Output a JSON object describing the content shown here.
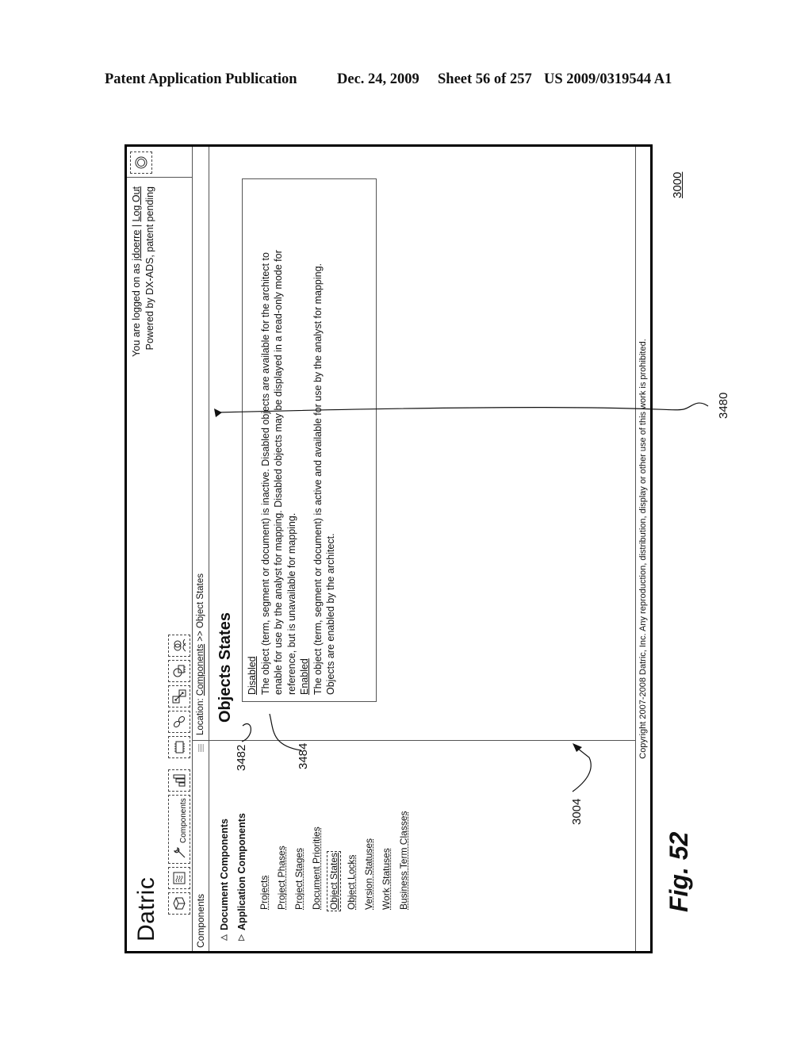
{
  "patent_header": {
    "publication": "Patent Application Publication",
    "date": "Dec. 24, 2009",
    "sheet": "Sheet 56 of 257",
    "number": "US 2009/0319544 A1"
  },
  "app": {
    "logo": "Datric",
    "toolbar": {
      "items": [
        {
          "icon": "cube-icon",
          "label": ""
        },
        {
          "icon": "wave-document-icon",
          "label": ""
        },
        {
          "icon": "wrench-icon",
          "label": "Components"
        },
        {
          "icon": "layout-blocks-icon",
          "label": ""
        },
        {
          "icon": "chip-icon",
          "label": ""
        },
        {
          "icon": "link-icon",
          "label": ""
        },
        {
          "icon": "map-arrows-icon",
          "label": ""
        },
        {
          "icon": "magnifier-chip-icon",
          "label": ""
        },
        {
          "icon": "users-icon",
          "label": ""
        }
      ]
    },
    "user": {
      "logged_prefix": "You are logged on as",
      "username": "jdoerre",
      "separator": "|",
      "logout": "Log Out",
      "powered_by": "Powered by DX-ADS, patent pending"
    },
    "help_icon": "help-circle-icon",
    "sidebar": {
      "header": "Components",
      "sections": [
        {
          "label": "Document Components",
          "expanded": false
        },
        {
          "label": "Application Components",
          "expanded": true
        }
      ],
      "items": [
        {
          "label": "Projects",
          "selected": false
        },
        {
          "label": "Project Phases",
          "selected": false
        },
        {
          "label": "Project Stages",
          "selected": false
        },
        {
          "label": "Document Priorities",
          "selected": false
        },
        {
          "label": "Object States",
          "selected": true
        },
        {
          "label": "Object Locks",
          "selected": false
        },
        {
          "label": "Version Statuses",
          "selected": false
        },
        {
          "label": "Work Statuses",
          "selected": false
        },
        {
          "label": "Business Term Classes",
          "selected": false
        }
      ]
    },
    "location": {
      "prefix": "Location:",
      "crumb_link": "Components",
      "separator": ">>",
      "current": "Object States"
    },
    "page_title": "Objects States",
    "definitions": [
      {
        "term": "Disabled",
        "lines": [
          "The object (term, segment or document) is inactive.  Disabled objects are available for the architect to",
          "enable for use by the analyst for mapping. Disabled objects may be displayed in a read-only mode for",
          "reference, but is unavailable for mapping."
        ]
      },
      {
        "term": "Enabled",
        "lines": [
          "The object (term, segment or document) is active and available for use by the analyst for mapping.",
          "Objects are enabled by the architect."
        ]
      }
    ],
    "footer": "Copyright 2007-2008 Datric, Inc.  Any reproduction, distribution, display or other use of this work is prohibited."
  },
  "annotations": {
    "ref_3480": "3480",
    "ref_3482": "3482",
    "ref_3484": "3484",
    "ref_3004": "3004",
    "ref_3000": "3000",
    "figure_label": "Fig. 52"
  }
}
